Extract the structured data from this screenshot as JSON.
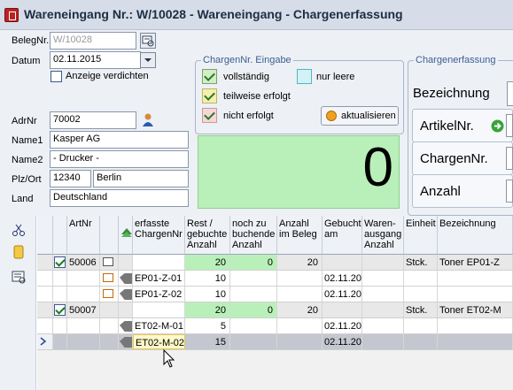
{
  "window": {
    "title": "Wareneingang Nr.: W/10028 - Wareneingang - Chargenerfassung"
  },
  "form": {
    "belegnr": {
      "label": "BelegNr.",
      "value": "W/10028"
    },
    "datum": {
      "label": "Datum",
      "value": "02.11.2015"
    },
    "anzeige_verdichten": {
      "label": "Anzeige verdichten",
      "checked": false
    },
    "adrnr": {
      "label": "AdrNr",
      "value": "70002"
    },
    "name1": {
      "label": "Name1",
      "value": "Kasper AG"
    },
    "name2": {
      "label": "Name2",
      "value": "- Drucker -"
    },
    "plzort": {
      "label": "Plz/Ort",
      "plz": "12340",
      "ort": "Berlin"
    },
    "land": {
      "label": "Land",
      "value": "Deutschland"
    }
  },
  "chargen_eingabe": {
    "title": "ChargenNr. Eingabe",
    "vollstaendig": "vollständig",
    "teilweise": "teilweise erfolgt",
    "nicht": "nicht erfolgt",
    "nur_leere": "nur leere",
    "aktualisieren": "aktualisieren",
    "counter": "0"
  },
  "chargenerfassung": {
    "title": "Chargenerfassung",
    "bezeichnung": "Bezeichnung",
    "artikelnr": "ArtikelNr.",
    "chargennr": "ChargenNr.",
    "anzahl": "Anzahl"
  },
  "grid": {
    "headers": {
      "artnr": "ArtNr",
      "erfasste": "erfasste ChargenNr",
      "rest": "Rest / gebuchte Anzahl",
      "noch": "noch zu buchende Anzahl",
      "anzahl": "Anzahl im Beleg",
      "gebucht": "Gebucht am",
      "waren": "Waren- ausgang Anzahl",
      "einheit": "Einheit",
      "bez": "Bezeichnung"
    },
    "rows": [
      {
        "artnr": "50006",
        "charge": "",
        "rest": "20",
        "noch": "0",
        "anzahl": "20",
        "gebucht": "",
        "einheit": "Stck.",
        "bez": "Toner EP01-Z"
      },
      {
        "artnr": "",
        "charge": "EP01-Z-01",
        "rest": "10",
        "noch": "",
        "anzahl": "",
        "gebucht": "02.11.20",
        "einheit": "",
        "bez": ""
      },
      {
        "artnr": "",
        "charge": "EP01-Z-02",
        "rest": "10",
        "noch": "",
        "anzahl": "",
        "gebucht": "02.11.20",
        "einheit": "",
        "bez": ""
      },
      {
        "artnr": "50007",
        "charge": "",
        "rest": "20",
        "noch": "0",
        "anzahl": "20",
        "gebucht": "",
        "einheit": "Stck.",
        "bez": "Toner ET02-M"
      },
      {
        "artnr": "",
        "charge": "ET02-M-01",
        "rest": "5",
        "noch": "",
        "anzahl": "",
        "gebucht": "02.11.20",
        "einheit": "",
        "bez": ""
      },
      {
        "artnr": "",
        "charge": "ET02-M-02",
        "rest": "15",
        "noch": "",
        "anzahl": "",
        "gebucht": "02.11.20",
        "einheit": "",
        "bez": ""
      }
    ]
  },
  "colors": {
    "green_fill": "#b9f0b9",
    "title_text": "#1c2d44",
    "group_title": "#3b5f92"
  }
}
